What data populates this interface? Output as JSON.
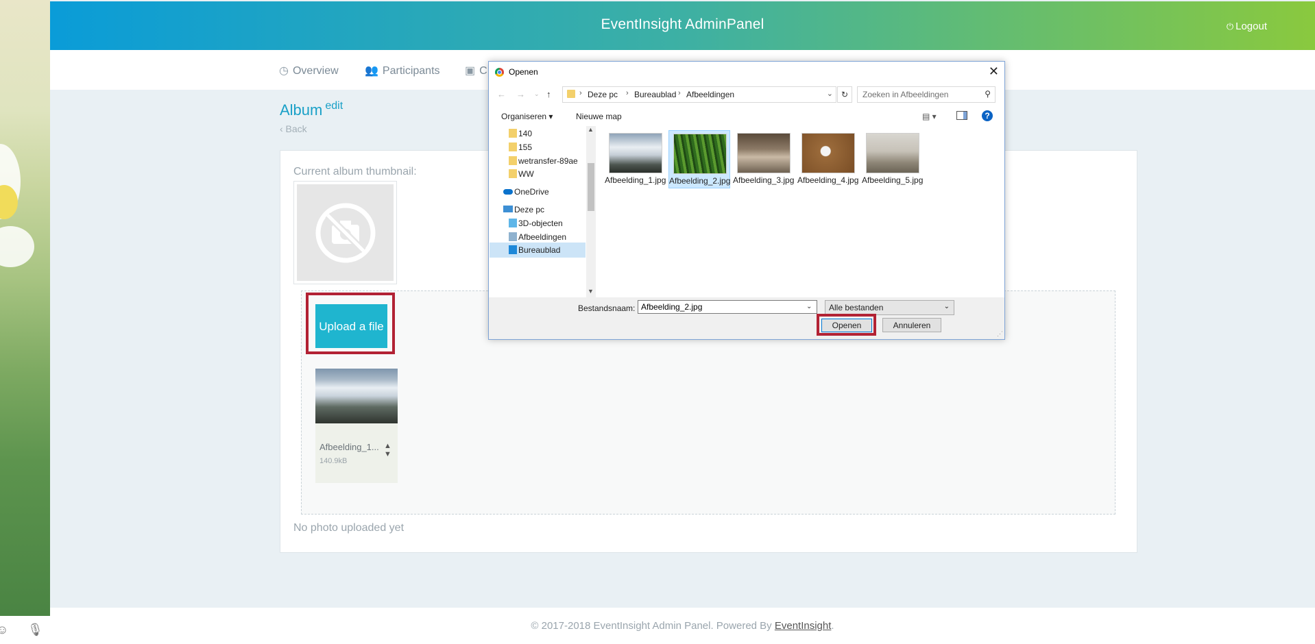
{
  "header": {
    "title": "EventInsight AdminPanel",
    "logout_label": "Logout"
  },
  "nav": [
    {
      "label": "Overview",
      "icon": "dashboard-icon"
    },
    {
      "label": "Participants",
      "icon": "users-icon"
    },
    {
      "label": "C",
      "icon": "save-icon"
    }
  ],
  "page": {
    "title": "Album",
    "edit_label": "edit",
    "back_label": "‹ Back",
    "thumbnail_label": "Current album thumbnail:",
    "upload_label": "Upload a file",
    "no_photo": "No photo uploaded yet"
  },
  "uploaded_file": {
    "name": "Afbeelding_1...",
    "size": "140.9kB"
  },
  "footer": {
    "text": "© 2017-2018 EventInsight Admin Panel. Powered By ",
    "brand": "EventInsight",
    "suffix": "."
  },
  "dialog": {
    "title": "Openen",
    "breadcrumbs": [
      "Deze pc",
      "Bureaublad",
      "Afbeeldingen"
    ],
    "search_placeholder": "Zoeken in Afbeeldingen",
    "organize_label": "Organiseren",
    "new_folder_label": "Nieuwe map",
    "tree": [
      {
        "label": "140",
        "selected": false
      },
      {
        "label": "155",
        "selected": false
      },
      {
        "label": "wetransfer-89ae",
        "selected": false
      },
      {
        "label": "WW",
        "selected": false
      },
      {
        "label": "OneDrive",
        "selected": false
      },
      {
        "label": "Deze pc",
        "selected": false
      },
      {
        "label": "3D-objecten",
        "selected": false
      },
      {
        "label": "Afbeeldingen",
        "selected": false
      },
      {
        "label": "Bureaublad",
        "selected": true
      }
    ],
    "files": [
      {
        "name": "Afbeelding_1.jpg",
        "selected": false
      },
      {
        "name": "Afbeelding_2.jpg",
        "selected": true
      },
      {
        "name": "Afbeelding_3.jpg",
        "selected": false
      },
      {
        "name": "Afbeelding_4.jpg",
        "selected": false
      },
      {
        "name": "Afbeelding_5.jpg",
        "selected": false
      }
    ],
    "filename_label": "Bestandsnaam:",
    "filename_value": "Afbeelding_2.jpg",
    "filter_label": "Alle bestanden",
    "open_label": "Openen",
    "cancel_label": "Annuleren"
  },
  "colors": {
    "accent": "#1fb5cf",
    "highlight": "#b22234",
    "header_start": "#0a9cd8",
    "header_end": "#8ac93e"
  }
}
